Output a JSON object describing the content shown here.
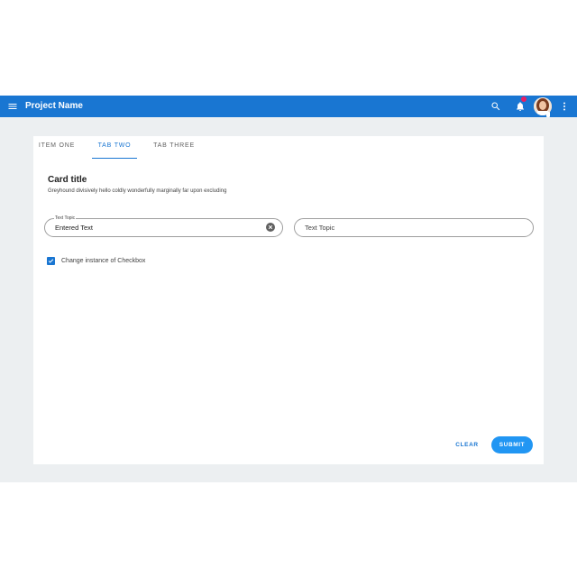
{
  "app": {
    "title": "Project Name",
    "accent_color": "#1976d2",
    "notification_color": "#e91e63",
    "icons": {
      "menu": "menu-icon",
      "search": "search-icon",
      "notifications": "bell-icon",
      "more": "more-vert-icon"
    }
  },
  "tabs": [
    {
      "label": "ITEM ONE",
      "active": false
    },
    {
      "label": "TAB TWO",
      "active": true
    },
    {
      "label": "TAB THREE",
      "active": false
    }
  ],
  "card": {
    "title": "Card title",
    "subtitle": "Greyhound divisively hello coldly wonderfully marginally far upon excluding"
  },
  "fields": [
    {
      "label": "Text Topic",
      "value": "Entered Text",
      "clearable": true
    },
    {
      "placeholder": "Text Topic",
      "value": ""
    }
  ],
  "checkbox": {
    "label": "Change instance of Checkbox",
    "checked": true
  },
  "actions": {
    "clear_label": "CLEAR",
    "submit_label": "SUBMIT"
  }
}
